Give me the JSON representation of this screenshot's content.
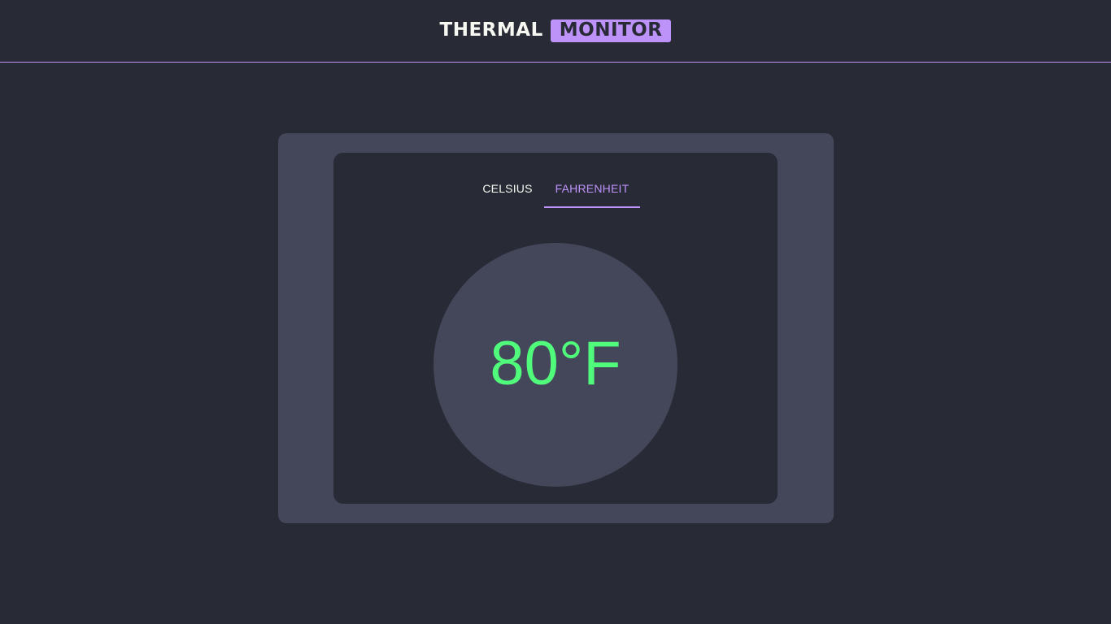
{
  "header": {
    "title_part1": "THERMAL",
    "title_part2": "MONITOR"
  },
  "tabs": [
    {
      "label": "CELSIUS",
      "active": false
    },
    {
      "label": "FAHRENHEIT",
      "active": true
    }
  ],
  "reading": {
    "value": 80,
    "unit": "°F",
    "display": "80°F"
  },
  "colors": {
    "background": "#282a36",
    "card": "#44475a",
    "accent": "#bd93f9",
    "reading": "#50fa7b",
    "text": "#f8f8f2"
  }
}
